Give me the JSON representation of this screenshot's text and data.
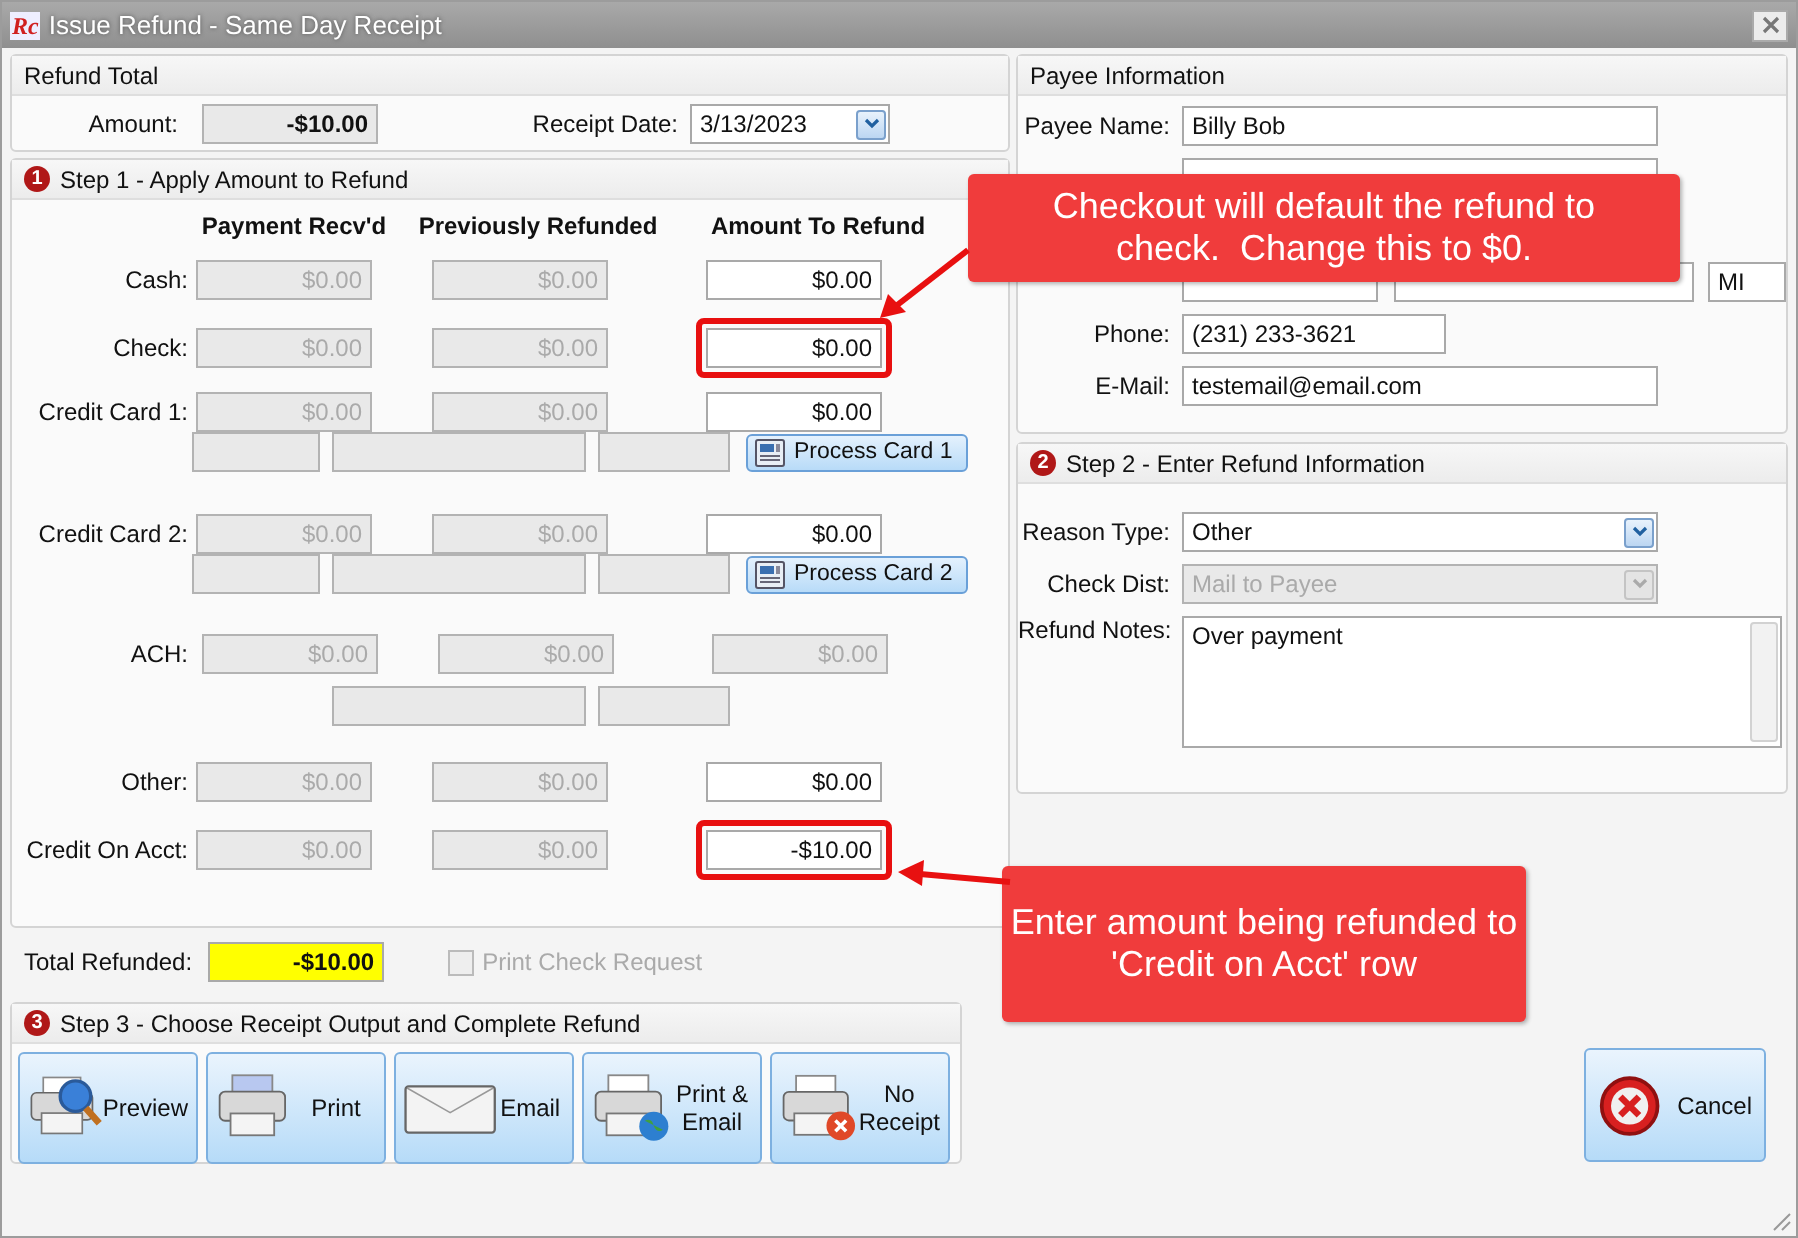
{
  "window": {
    "logo": "Rc",
    "title": "Issue Refund - Same Day Receipt"
  },
  "refund_total": {
    "title": "Refund Total",
    "amount_label": "Amount:",
    "amount": "-$10.00",
    "date_label": "Receipt Date:",
    "date": "3/13/2023"
  },
  "step1": {
    "number": "1",
    "title": "Step 1 - Apply Amount to Refund",
    "columns": [
      "Payment Recv'd",
      "Previously Refunded",
      "Amount To Refund"
    ],
    "rows": [
      {
        "kind": "plain",
        "label": "Cash:",
        "payment": "$0.00",
        "previous": "$0.00",
        "refund": "$0.00",
        "refund_disabled": false,
        "highlighted": false
      },
      {
        "kind": "plain",
        "label": "Check:",
        "payment": "$0.00",
        "previous": "$0.00",
        "refund": "$0.00",
        "refund_disabled": false,
        "highlighted": true
      },
      {
        "kind": "card",
        "label": "Credit Card 1:",
        "payment": "$0.00",
        "previous": "$0.00",
        "refund": "$0.00",
        "refund_disabled": false,
        "highlighted": false,
        "button": "Process Card 1"
      },
      {
        "kind": "card",
        "label": "Credit Card 2:",
        "payment": "$0.00",
        "previous": "$0.00",
        "refund": "$0.00",
        "refund_disabled": false,
        "highlighted": false,
        "button": "Process Card 2"
      },
      {
        "kind": "ach",
        "label": "ACH:",
        "payment": "$0.00",
        "previous": "$0.00",
        "refund": "$0.00",
        "refund_disabled": true,
        "highlighted": false
      },
      {
        "kind": "plain",
        "label": "Other:",
        "payment": "$0.00",
        "previous": "$0.00",
        "refund": "$0.00",
        "refund_disabled": false,
        "highlighted": false
      },
      {
        "kind": "plain",
        "label": "Credit On Acct:",
        "payment": "$0.00",
        "previous": "$0.00",
        "refund": "-$10.00",
        "refund_disabled": false,
        "highlighted": true
      }
    ]
  },
  "totals": {
    "label": "Total Refunded:",
    "value": "-$10.00",
    "print_check": {
      "label": "Print Check Request",
      "checked": false,
      "disabled": true
    }
  },
  "step3": {
    "number": "3",
    "title": "Step 3 - Choose Receipt Output and Complete Refund",
    "buttons": [
      {
        "kind": "preview",
        "label": "Preview"
      },
      {
        "kind": "print",
        "label": "Print"
      },
      {
        "kind": "email",
        "label": "Email"
      },
      {
        "kind": "print_email",
        "label": "Print & Email"
      },
      {
        "kind": "no_receipt",
        "label": "No Receipt"
      }
    ]
  },
  "payee": {
    "title": "Payee Information",
    "name_label": "Payee Name:",
    "name": "Billy Bob",
    "state": "MI",
    "phone_label": "Phone:",
    "phone": "(231) 233-3621",
    "email_label": "E-Mail:",
    "email": "testemail@email.com"
  },
  "step2": {
    "number": "2",
    "title": "Step 2 - Enter Refund Information",
    "reason_label": "Reason Type:",
    "reason": "Other",
    "dist_label": "Check Dist:",
    "dist": "Mail to Payee",
    "dist_disabled": true,
    "notes_label": "Refund Notes:",
    "notes": "Over payment"
  },
  "cancel": {
    "label": "Cancel"
  },
  "callouts": [
    {
      "text": "Checkout will default the refund to check.  Change this to $0."
    },
    {
      "text": "Enter amount being refunded to 'Credit on Acct' row"
    }
  ]
}
